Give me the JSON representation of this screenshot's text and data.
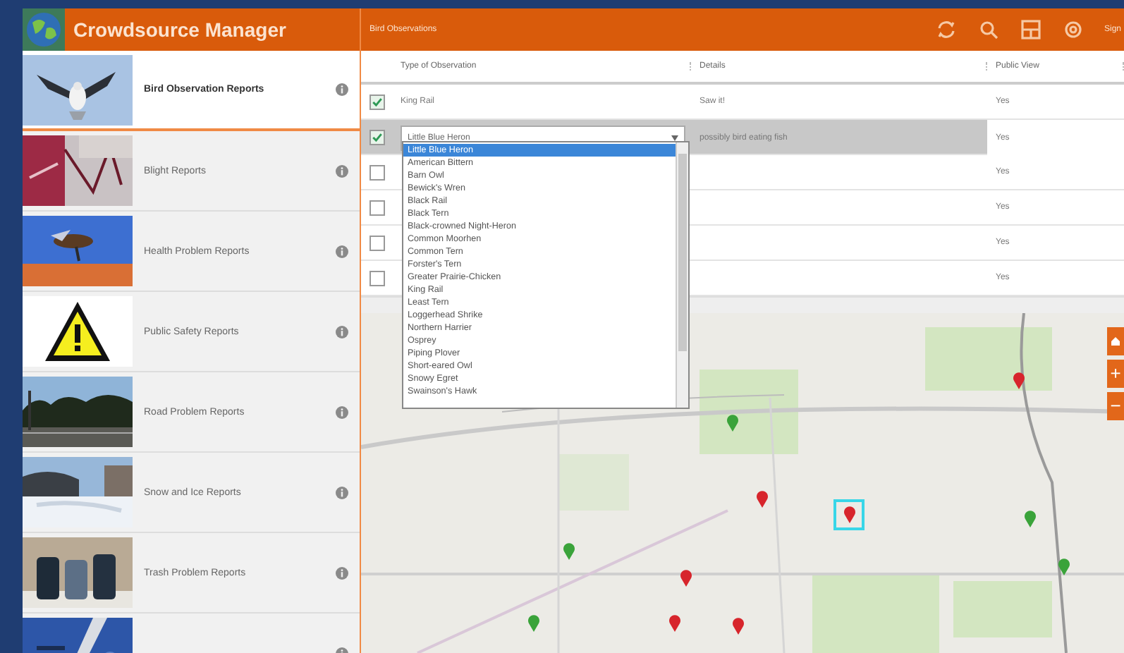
{
  "app": {
    "title": "Crowdsource Manager"
  },
  "sidebar": {
    "items": [
      {
        "label": "Bird Observation Reports",
        "selected": true
      },
      {
        "label": "Blight Reports",
        "selected": false
      },
      {
        "label": "Health Problem Reports",
        "selected": false
      },
      {
        "label": "Public Safety Reports",
        "selected": false
      },
      {
        "label": "Road Problem Reports",
        "selected": false
      },
      {
        "label": "Snow and Ice Reports",
        "selected": false
      },
      {
        "label": "Trash Problem Reports",
        "selected": false
      },
      {
        "selected": false
      }
    ]
  },
  "toolbar": {
    "layer_title": "Bird Observations",
    "sign_in": "Sign"
  },
  "table": {
    "columns": [
      "Type of Observation",
      "Details",
      "Public View"
    ],
    "rows": [
      {
        "checked": true,
        "selected": false,
        "type": "King Rail",
        "details": "Saw it!",
        "public_view": "Yes"
      },
      {
        "checked": true,
        "selected": true,
        "type": "Little Blue Heron",
        "details": "possibly bird eating fish",
        "public_view": "Yes",
        "editing": true
      },
      {
        "checked": false,
        "selected": false,
        "public_view": "Yes"
      },
      {
        "checked": false,
        "selected": false,
        "public_view": "Yes"
      },
      {
        "checked": false,
        "selected": false,
        "public_view": "Yes"
      },
      {
        "checked": false,
        "selected": false,
        "public_view": "Yes"
      }
    ]
  },
  "dropdown": {
    "options": [
      {
        "label": "Little Blue Heron",
        "selected": true
      },
      {
        "label": "American Bittern",
        "selected": false
      },
      {
        "label": "Barn Owl",
        "selected": false
      },
      {
        "label": "Bewick's Wren",
        "selected": false
      },
      {
        "label": "Black Rail",
        "selected": false
      },
      {
        "label": "Black Tern",
        "selected": false
      },
      {
        "label": "Black-crowned Night-Heron",
        "selected": false
      },
      {
        "label": "Common Moorhen",
        "selected": false
      },
      {
        "label": "Common Tern",
        "selected": false
      },
      {
        "label": "Forster's Tern",
        "selected": false
      },
      {
        "label": "Greater Prairie-Chicken",
        "selected": false
      },
      {
        "label": "King Rail",
        "selected": false
      },
      {
        "label": "Least Tern",
        "selected": false
      },
      {
        "label": "Loggerhead Shrike",
        "selected": false
      },
      {
        "label": "Northern Harrier",
        "selected": false
      },
      {
        "label": "Osprey",
        "selected": false
      },
      {
        "label": "Piping Plover",
        "selected": false
      },
      {
        "label": "Short-eared Owl",
        "selected": false
      },
      {
        "label": "Snowy Egret",
        "selected": false
      },
      {
        "label": "Swainson's Hawk",
        "selected": false
      }
    ]
  },
  "map": {
    "zoom_in": "+",
    "zoom_out": "−",
    "pins": [
      {
        "color": "#d7252c",
        "selected": false
      },
      {
        "color": "#d7252c",
        "selected": false
      },
      {
        "color": "#d7252c",
        "selected": true
      },
      {
        "color": "#d7252c",
        "selected": false
      },
      {
        "color": "#d7252c",
        "selected": false
      },
      {
        "color": "#d7252c",
        "selected": false
      },
      {
        "color": "#3aa33a",
        "selected": false
      },
      {
        "color": "#3aa33a",
        "selected": false
      },
      {
        "color": "#3aa33a",
        "selected": false
      },
      {
        "color": "#3aa33a",
        "selected": false
      },
      {
        "color": "#3aa33a",
        "selected": false
      }
    ]
  }
}
